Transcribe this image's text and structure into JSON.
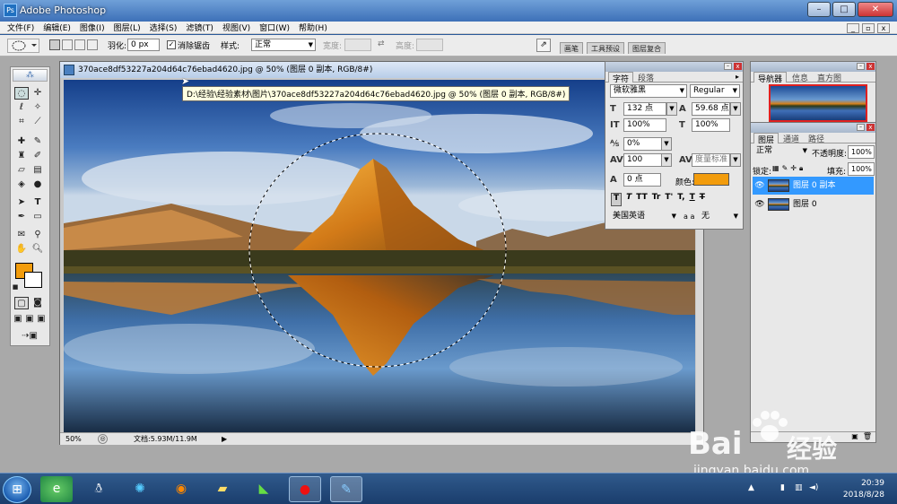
{
  "app": {
    "title": "Adobe Photoshop"
  },
  "menu": [
    "文件(F)",
    "编辑(E)",
    "图像(I)",
    "图层(L)",
    "选择(S)",
    "滤镜(T)",
    "视图(V)",
    "窗口(W)",
    "帮助(H)"
  ],
  "options": {
    "feather_label": "羽化:",
    "feather_value": "0 px",
    "antialias_label": "消除锯齿",
    "style_label": "样式:",
    "style_value": "正常",
    "width_label": "宽度:",
    "height_label": "高度:",
    "well_tabs": [
      "画笔",
      "工具预设",
      "图层复合"
    ]
  },
  "document": {
    "title": "370ace8df53227a204d64c76ebad4620.jpg @ 50% (图层 0 副本, RGB/8#)",
    "tooltip": "D:\\经验\\经验素材\\图片\\370ace8df53227a204d64c76ebad4620.jpg @ 50% (图层 0 副本, RGB/8#)",
    "zoom": "50%",
    "doc_size": "文档:5.93M/11.9M"
  },
  "colors": {
    "foreground": "#f29c0c",
    "background": "#ffffff",
    "text_color": "#f29c0c"
  },
  "character": {
    "tabs": [
      "字符",
      "段落"
    ],
    "font_family": "微软雅黑",
    "font_style": "Regular",
    "font_size": "132 点",
    "leading": "59.68 点",
    "vscale": "100%",
    "hscale": "100%",
    "tracking": "0%",
    "kerning_value": "100",
    "kerning_method": "度量标准",
    "baseline": "0 点",
    "color_label": "颜色:",
    "style_buttons": [
      "T",
      "T",
      "TT",
      "Tr",
      "T'",
      "T,",
      "T",
      "T"
    ],
    "language": "美国英语",
    "aa_label": "a a",
    "aa_value": "无"
  },
  "navigator": {
    "tabs": [
      "导航器",
      "信息",
      "直方图"
    ]
  },
  "layers": {
    "tabs": [
      "图层",
      "通道",
      "路径"
    ],
    "blend_mode": "正常",
    "opacity_label": "不透明度:",
    "opacity_value": "100%",
    "lock_label": "锁定:",
    "fill_label": "填充:",
    "fill_value": "100%",
    "items": [
      {
        "name": "图层 0 副本",
        "selected": true
      },
      {
        "name": "图层 0",
        "selected": false
      }
    ]
  },
  "watermark": {
    "brand": "Bai",
    "brand2": "经验",
    "url": "jingyan.baidu.com"
  },
  "taskbar": {
    "items": [
      "ie-icon",
      "qq-icon",
      "media-icon",
      "firefox-icon",
      "folder-icon",
      "app-icon",
      "record-icon",
      "photoshop-icon"
    ],
    "time": "20:39",
    "date": "2018/8/28"
  }
}
